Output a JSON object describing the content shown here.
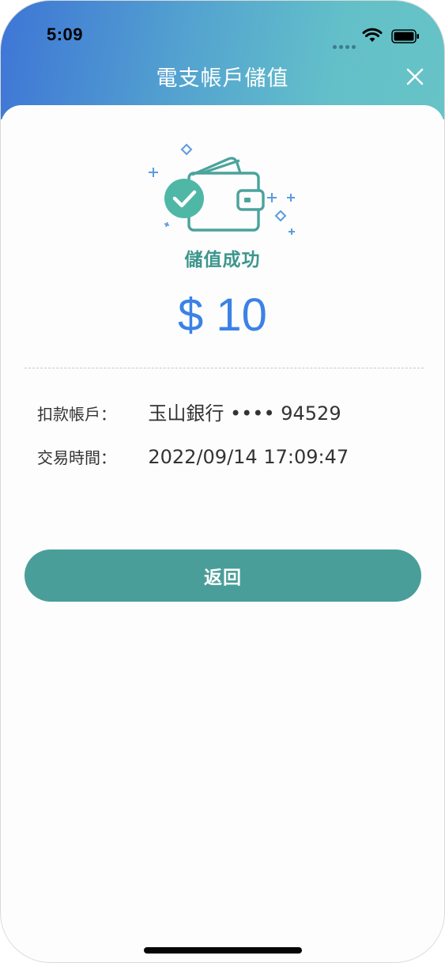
{
  "status_bar": {
    "time": "5:09",
    "icons": [
      "signal-dots-icon",
      "wifi-icon",
      "battery-icon"
    ]
  },
  "header": {
    "title": "電支帳戶儲值",
    "close_icon": "close-icon",
    "gradient_colors": [
      "#3e75d6",
      "#66c3c6"
    ]
  },
  "result": {
    "illustration": "wallet-success-icon",
    "status_text": "儲值成功",
    "amount": "$ 10",
    "accent_color": "#3b82e6",
    "success_color": "#3d968d"
  },
  "details": [
    {
      "label": "扣款帳戶：",
      "value": "玉山銀行 •••• 94529"
    },
    {
      "label": "交易時間：",
      "value": "2022/09/14 17:09:47"
    }
  ],
  "actions": {
    "back_label": "返回",
    "button_color": "#4a9e99"
  }
}
